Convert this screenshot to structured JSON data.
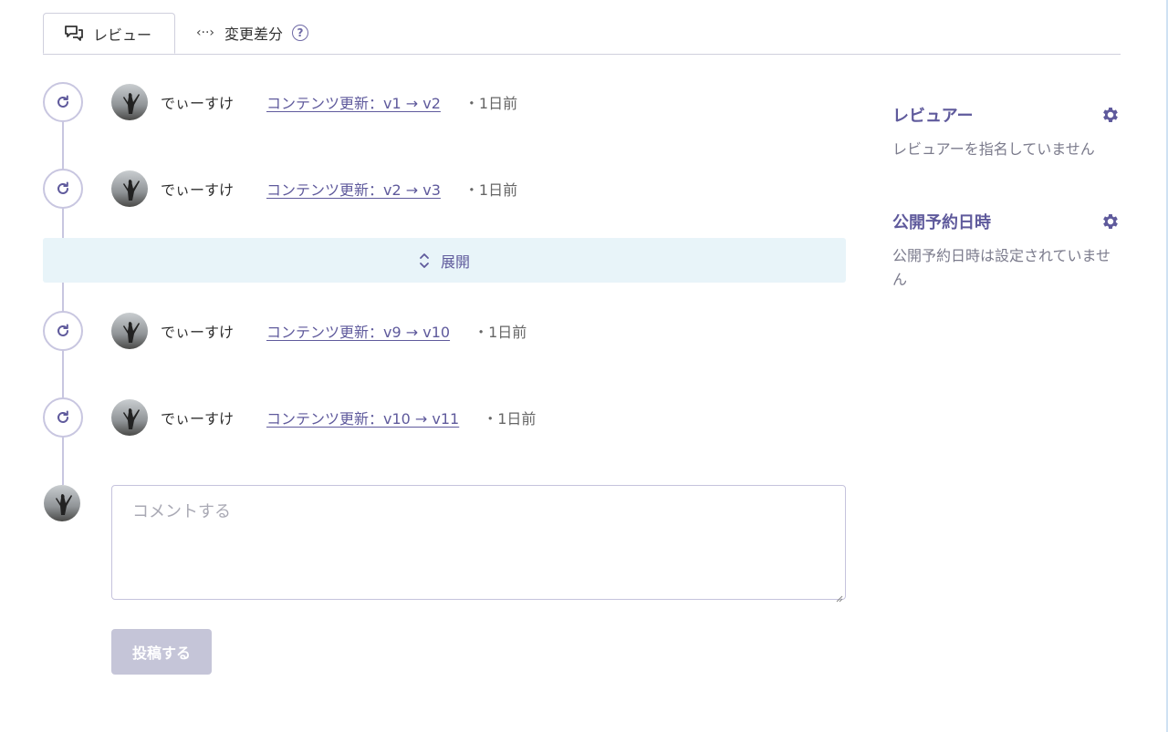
{
  "tabs": {
    "review_label": "レビュー",
    "diff_label": "変更差分"
  },
  "timeline": {
    "items": [
      {
        "user": "でぃーすけ",
        "link": "コンテンツ更新：v1 → v2",
        "time": "・1日前"
      },
      {
        "user": "でぃーすけ",
        "link": "コンテンツ更新：v2 → v3",
        "time": "・1日前"
      },
      {
        "user": "でぃーすけ",
        "link": "コンテンツ更新：v9 → v10",
        "time": "・1日前"
      },
      {
        "user": "でぃーすけ",
        "link": "コンテンツ更新：v10 → v11",
        "time": "・1日前"
      }
    ],
    "expand_label": "展開"
  },
  "comment": {
    "placeholder": "コメントする",
    "submit_label": "投稿する"
  },
  "sidebar": {
    "reviewers": {
      "title": "レビュアー",
      "empty_text": "レビュアーを指名していません"
    },
    "schedule": {
      "title": "公開予約日時",
      "empty_text": "公開予約日時は設定されていません"
    }
  },
  "colors": {
    "accent": "#5f5a9c",
    "expand_bg": "#e8f4f9",
    "button_disabled": "#c5c5d8"
  }
}
